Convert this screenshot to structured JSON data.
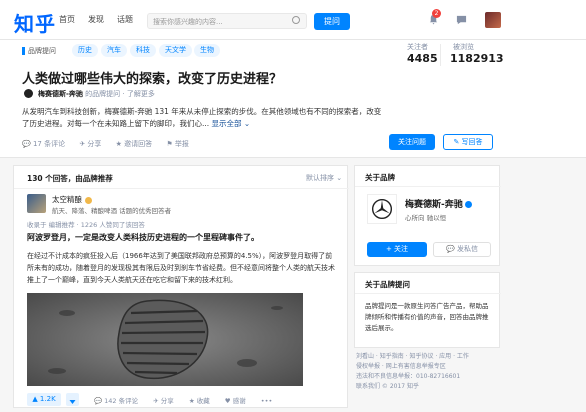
{
  "header": {
    "logo": "知乎",
    "nav": [
      "首页",
      "发现",
      "话题"
    ],
    "search_placeholder": "搜索你感兴趣的内容...",
    "ask_label": "提问",
    "notification_count": "2"
  },
  "question": {
    "brand_tag": "品牌提问",
    "topics": [
      "历史",
      "汽车",
      "科技",
      "天文学",
      "生物"
    ],
    "followers_label": "关注者",
    "followers": "4485",
    "views_label": "被浏览",
    "views": "1182913",
    "title": "人类做过哪些伟大的探索，改变了历史进程？",
    "author_name": "梅赛德斯-奔驰",
    "author_suffix": "的品牌提问 · 了解更多",
    "description": "从发明汽车到科技创新，梅赛德斯-奔驰 131 年来从未停止探索的步伐。在其他领域也有不同的探索者，改变了历史进程。对每一个在未知路上留下的脚印，我们心...",
    "show_all": "显示全部 ⌄",
    "actions": [
      "💬 17 条评论",
      "✈ 分享",
      "★ 邀请回答",
      "⚑ 举报"
    ],
    "follow_label": "关注问题",
    "write_label": "✎ 写回答"
  },
  "answers": {
    "header": "130 个回答，由品牌推荐",
    "sort": "默认排序 ⌄",
    "author": "太空精酿",
    "bio": "航天、降落、精酿啤酒 话题的优秀回答者",
    "meta": "收录于 编辑推荐 · 1226 人赞同了该回答",
    "headline": "阿波罗登月，一定是改变人类科技历史进程的一个里程碑事件了。",
    "body": "在经过不计成本的疯狂投入后（1966年达到了美国联邦政府总预算的4.5%），阿波罗登月取得了前所未有的成功，随着登月的发现极其有限后及时到刹车节省经费。但不经意间将整个人类的航天技术推上了一个巅峰，直到今天人类航天还在吃它和留下来的技术红利。",
    "votes": "▲ 1.2K",
    "bottom": [
      "💬 142 条评论",
      "✈ 分享",
      "★ 收藏",
      "♥ 感谢",
      "•••"
    ]
  },
  "sidebar": {
    "about_brand": "关于品牌",
    "brand_name": "梅赛德斯-奔驰",
    "brand_bio": "心所向 驰以恒",
    "follow_label": "+ 关注",
    "message_label": "💬 发私信",
    "about_question": "关于品牌提问",
    "question_info": "品牌提问是一款原生问答广告产品，帮助品牌倾听和传播有价值的声音，回答由品牌推选后展示。",
    "footer": [
      "刘看山 · 知乎指南 · 知乎协议 · 应用 · 工作",
      "侵权举报 · 网上有害信息举报专区",
      "违法和不良信息举报：010-82716601",
      "联系我们 © 2017 知乎"
    ]
  },
  "colors": {
    "brand_blue": "#0084ff",
    "logo_blue": "#0066ff",
    "badge_red": "#f1403c"
  }
}
